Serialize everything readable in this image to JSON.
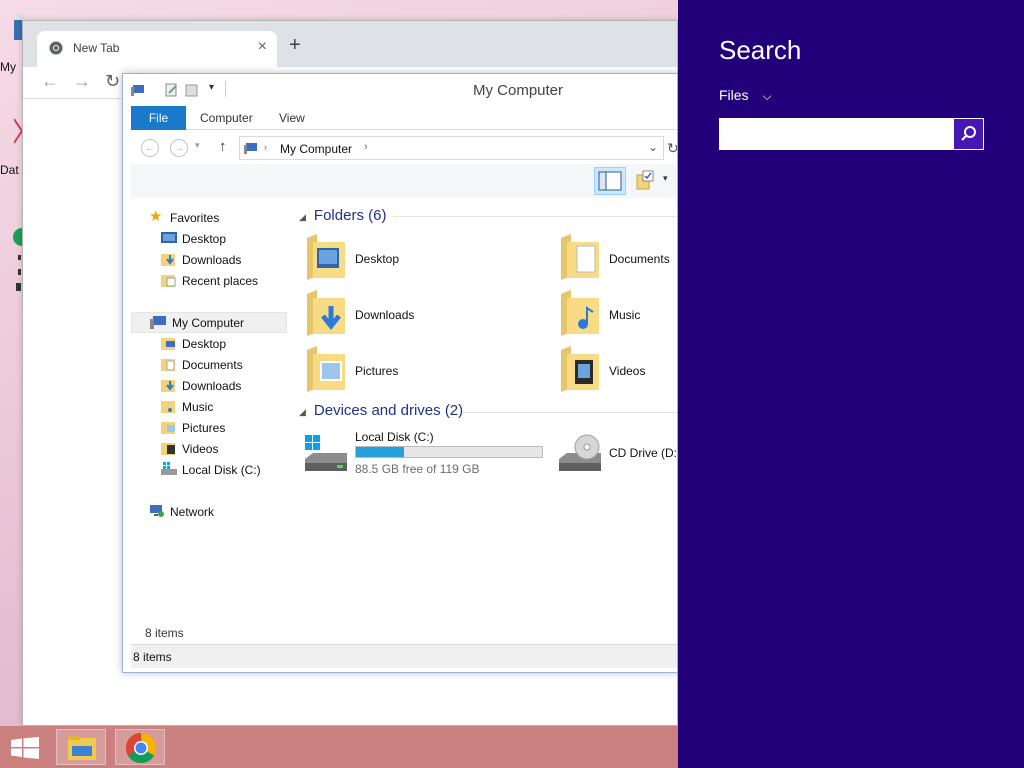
{
  "desktop": {
    "icons": [
      {
        "label": "My"
      },
      {
        "label": "Dat"
      }
    ]
  },
  "chrome": {
    "tab_title": "New Tab",
    "tab_close": "×",
    "new_tab": "+"
  },
  "explorer": {
    "title": "My Computer",
    "ribbon": {
      "file": "File",
      "computer": "Computer",
      "view": "View"
    },
    "address": {
      "location": "My Computer"
    },
    "nav": {
      "favorites": "Favorites",
      "favorites_items": [
        "Desktop",
        "Downloads",
        "Recent places"
      ],
      "computer": "My Computer",
      "computer_items": [
        "Desktop",
        "Documents",
        "Downloads",
        "Music",
        "Pictures",
        "Videos",
        "Local Disk (C:)"
      ],
      "network": "Network"
    },
    "folders": {
      "header": "Folders (6)",
      "items": [
        "Desktop",
        "Documents",
        "Downloads",
        "Music",
        "Pictures",
        "Videos"
      ]
    },
    "drives": {
      "header": "Devices and drives (2)",
      "local": {
        "label": "Local Disk (C:)",
        "free_text": "88.5 GB free of 119 GB",
        "used_fraction": 0.256
      },
      "cd": {
        "label": "CD Drive (D:"
      }
    },
    "item_count": "8 items",
    "status": "8 items"
  },
  "charm": {
    "title": "Search",
    "scope": "Files",
    "query": "",
    "placeholder": ""
  },
  "colors": {
    "charm_bg": "#21007a",
    "accent": "#1979ca",
    "drive_fill": "#26a0da"
  }
}
